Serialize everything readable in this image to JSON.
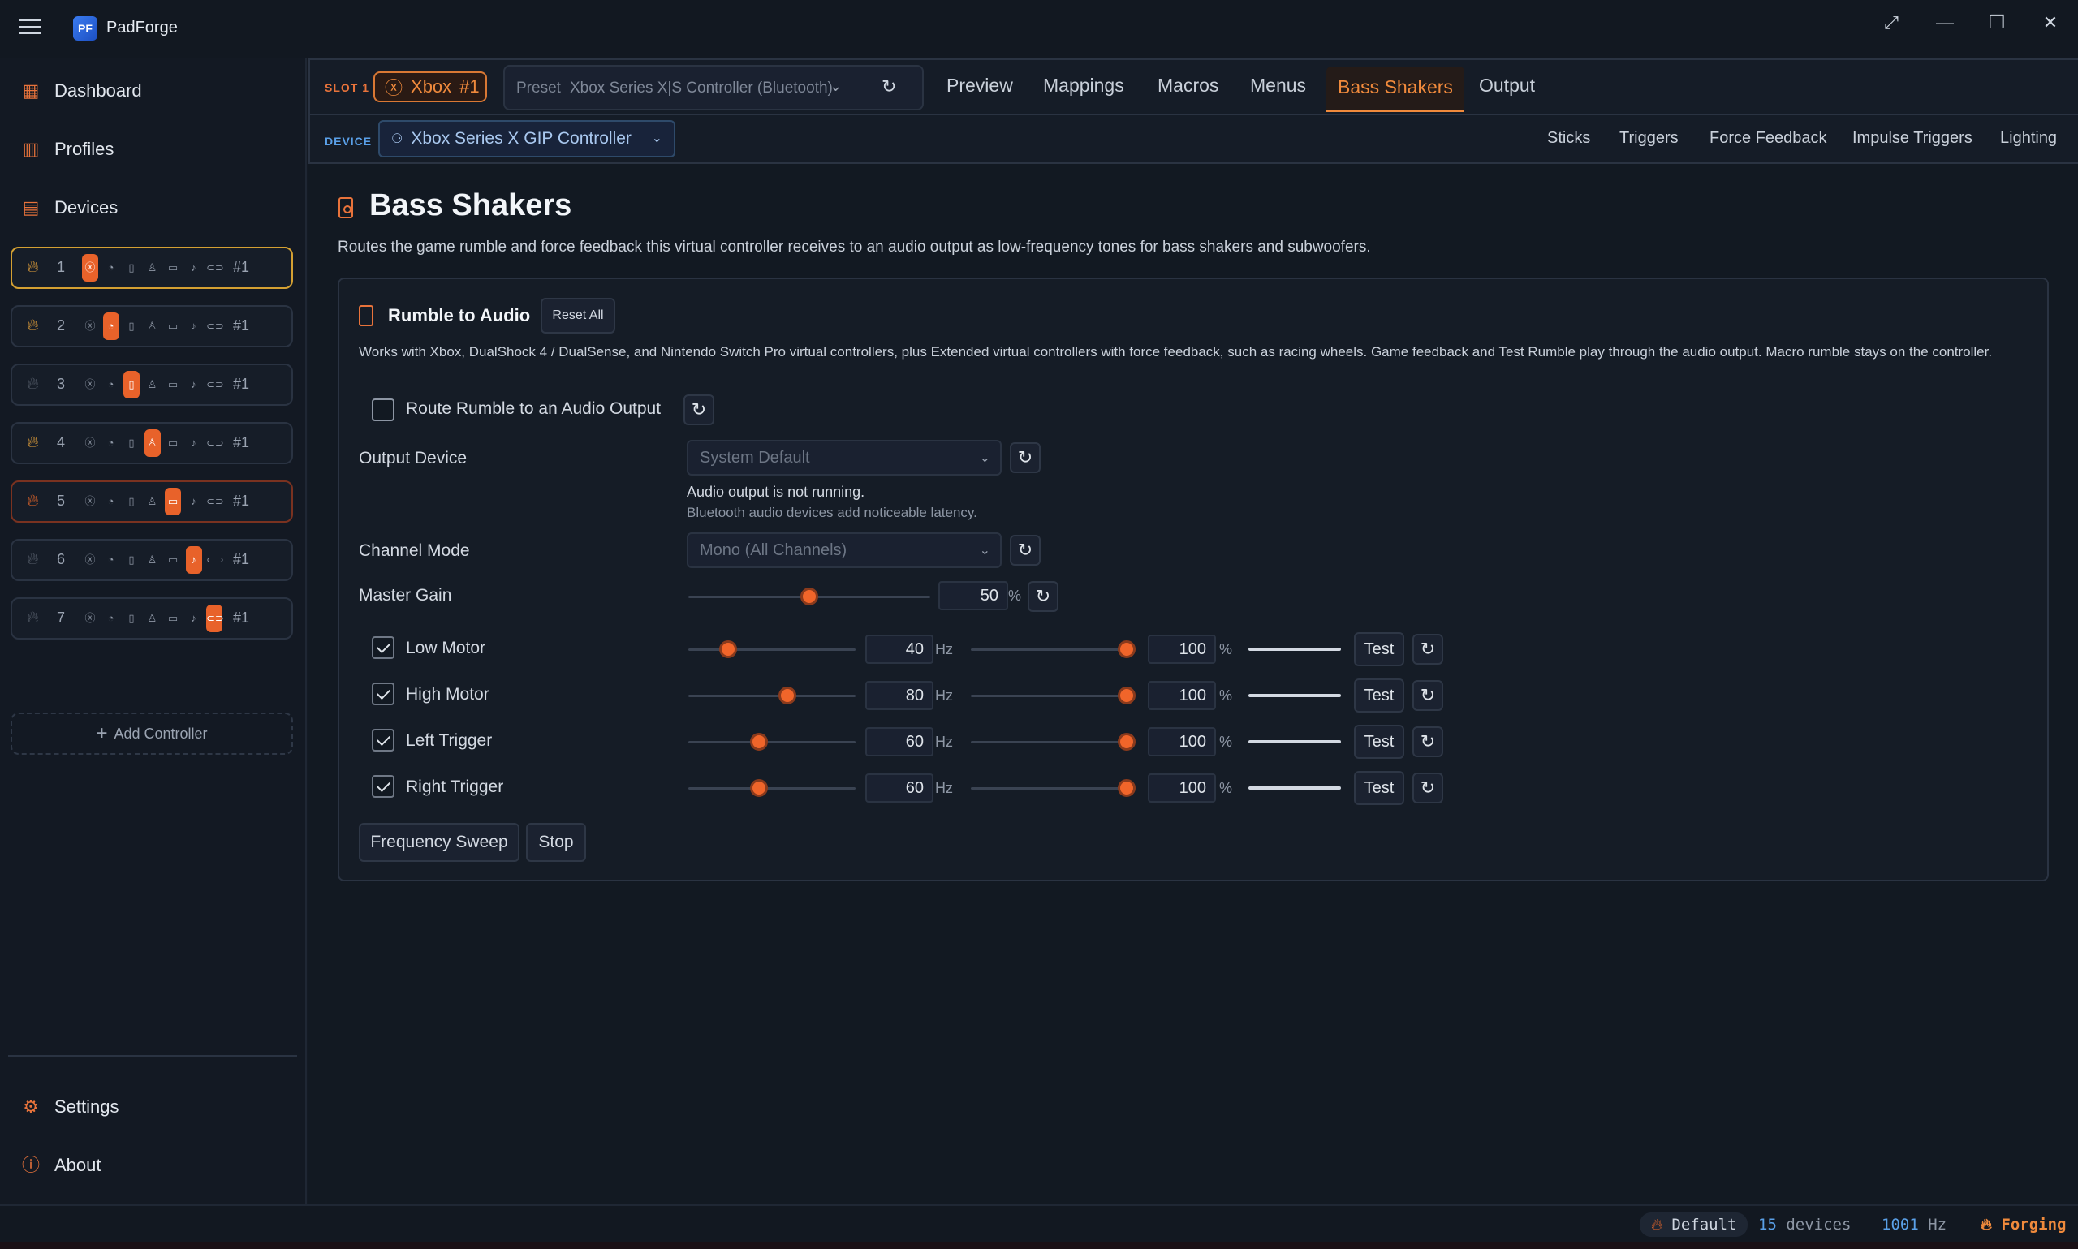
{
  "app": {
    "title": "PadForge",
    "logo_text": "PF"
  },
  "window_controls": {
    "expand": "⤢",
    "minimize": "—",
    "restore": "❐",
    "close": "✕"
  },
  "sidebar": {
    "nav": [
      {
        "label": "Dashboard",
        "icon": "dashboard-icon"
      },
      {
        "label": "Profiles",
        "icon": "books-icon"
      },
      {
        "label": "Devices",
        "icon": "devices-icon"
      }
    ],
    "slots": [
      {
        "num": "1",
        "tag": "#1",
        "active_type": 0,
        "state": "active"
      },
      {
        "num": "2",
        "tag": "#1",
        "active_type": 1,
        "state": "normal"
      },
      {
        "num": "3",
        "tag": "#1",
        "active_type": 2,
        "state": "dim"
      },
      {
        "num": "4",
        "tag": "#1",
        "active_type": 3,
        "state": "normal"
      },
      {
        "num": "5",
        "tag": "#1",
        "active_type": 4,
        "state": "hot"
      },
      {
        "num": "6",
        "tag": "#1",
        "active_type": 5,
        "state": "dim"
      },
      {
        "num": "7",
        "tag": "#1",
        "active_type": 6,
        "state": "dim"
      }
    ],
    "slot_type_icons": [
      "xbox-icon",
      "playstation-icon",
      "switch-icon",
      "person-icon",
      "keyboard-icon",
      "midi-icon",
      "gamepad-icon"
    ],
    "add_controller": "Add Controller",
    "bottom": [
      {
        "label": "Settings",
        "icon": "gear-icon"
      },
      {
        "label": "About",
        "icon": "info-icon"
      }
    ]
  },
  "header": {
    "slot_label": "SLOT 1",
    "controller_chip": {
      "name": "Xbox",
      "tag": "#1"
    },
    "preset": {
      "label": "Preset",
      "value": "Xbox Series X|S Controller (Bluetooth)"
    },
    "tabs": [
      "Preview",
      "Mappings",
      "Macros",
      "Menus",
      "Bass Shakers",
      "Output"
    ],
    "active_tab": "Bass Shakers",
    "device_label": "DEVICE",
    "device": "Xbox Series X GIP Controller",
    "subtabs": [
      "Sticks",
      "Triggers",
      "Force Feedback",
      "Impulse Triggers",
      "Lighting"
    ]
  },
  "page": {
    "title": "Bass Shakers",
    "description": "Routes the game rumble and force feedback this virtual controller receives to an audio output as low-frequency tones for bass shakers and subwoofers."
  },
  "rumble": {
    "title": "Rumble to Audio",
    "reset_all": "Reset All",
    "description": "Works with Xbox, DualShock 4 / DualSense, and Nintendo Switch Pro virtual controllers, plus Extended virtual controllers with force feedback, such as racing wheels. Game feedback and Test Rumble play through the audio output. Macro rumble stays on the controller.",
    "route_label": "Route Rumble to an Audio Output",
    "route_checked": false,
    "output_device_label": "Output Device",
    "output_device_value": "System Default",
    "status_note": "Audio output is not running.",
    "latency_note": "Bluetooth audio devices add noticeable latency.",
    "channel_mode_label": "Channel Mode",
    "channel_mode_value": "Mono (All Channels)",
    "master_gain_label": "Master Gain",
    "master_gain_value": "50",
    "master_gain_unit": "%",
    "master_gain_fraction": 0.5,
    "motors": [
      {
        "label": "Low Motor",
        "checked": true,
        "freq": "40",
        "freq_unit": "Hz",
        "freq_fraction": 0.24,
        "gain": "100",
        "gain_unit": "%",
        "gain_fraction": 1.0,
        "test": "Test"
      },
      {
        "label": "High Motor",
        "checked": true,
        "freq": "80",
        "freq_unit": "Hz",
        "freq_fraction": 0.59,
        "gain": "100",
        "gain_unit": "%",
        "gain_fraction": 1.0,
        "test": "Test"
      },
      {
        "label": "Left Trigger",
        "checked": true,
        "freq": "60",
        "freq_unit": "Hz",
        "freq_fraction": 0.42,
        "gain": "100",
        "gain_unit": "%",
        "gain_fraction": 1.0,
        "test": "Test"
      },
      {
        "label": "Right Trigger",
        "checked": true,
        "freq": "60",
        "freq_unit": "Hz",
        "freq_fraction": 0.42,
        "gain": "100",
        "gain_unit": "%",
        "gain_fraction": 1.0,
        "test": "Test"
      }
    ],
    "frequency_sweep": "Frequency Sweep",
    "stop": "Stop"
  },
  "statusbar": {
    "profile": "Default",
    "devices_count": "15",
    "devices_label": "devices",
    "rate": "1001",
    "rate_unit": "Hz",
    "state": "Forging"
  },
  "colors": {
    "accent": "#f0652a",
    "gold": "#d4a032",
    "blue": "#5aa0e8",
    "bg": "#141a24"
  }
}
